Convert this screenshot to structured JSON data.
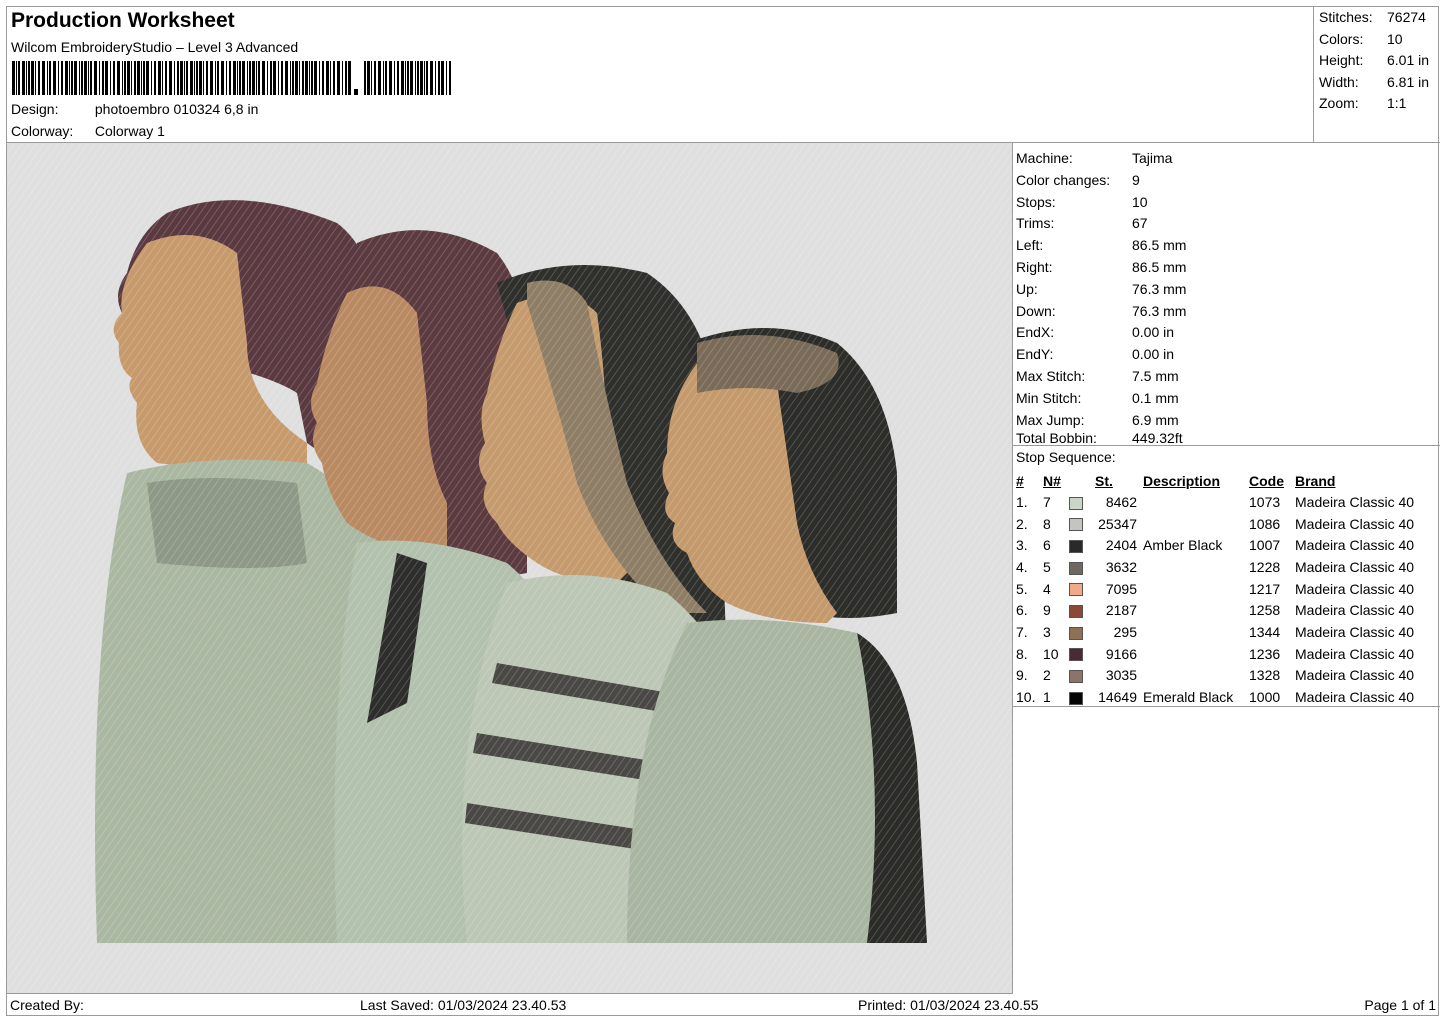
{
  "header": {
    "title": "Production Worksheet",
    "subtitle": "Wilcom EmbroideryStudio – Level 3 Advanced",
    "design_label": "Design:",
    "design_value": "photoembro 010324 6,8 in",
    "colorway_label": "Colorway:",
    "colorway_value": "Colorway 1"
  },
  "summary": [
    {
      "label": "Stitches:",
      "value": "76274"
    },
    {
      "label": "Colors:",
      "value": "10"
    },
    {
      "label": "Height:",
      "value": "6.01 in"
    },
    {
      "label": "Width:",
      "value": "6.81 in"
    },
    {
      "label": "Zoom:",
      "value": "1:1"
    }
  ],
  "info": [
    {
      "label": "Machine:",
      "value": "Tajima"
    },
    {
      "label": "Color changes:",
      "value": "9"
    },
    {
      "label": "Stops:",
      "value": "10"
    },
    {
      "label": "Trims:",
      "value": "67"
    },
    {
      "label": "Left:",
      "value": "86.5 mm"
    },
    {
      "label": "Right:",
      "value": "86.5 mm"
    },
    {
      "label": "Up:",
      "value": "76.3 mm"
    },
    {
      "label": "Down:",
      "value": "76.3 mm"
    },
    {
      "label": "EndX:",
      "value": "0.00 in"
    },
    {
      "label": "EndY:",
      "value": "0.00 in"
    },
    {
      "label": "Max Stitch:",
      "value": "7.5 mm"
    },
    {
      "label": "Min Stitch:",
      "value": "0.1 mm"
    },
    {
      "label": "Max Jump:",
      "value": "6.9 mm"
    },
    {
      "label": "Total Bobbin:",
      "value": "449.32ft"
    }
  ],
  "stops": {
    "caption": "Stop Sequence:",
    "headers": {
      "num": "#",
      "n": "N#",
      "st": "St.",
      "desc": "Description",
      "code": "Code",
      "brand": "Brand"
    },
    "rows": [
      {
        "num": "1.",
        "n": "7",
        "color": "#c9d6c9",
        "st": "8462",
        "desc": "",
        "code": "1073",
        "brand": "Madeira Classic 40"
      },
      {
        "num": "2.",
        "n": "8",
        "color": "#c4c4c0",
        "st": "25347",
        "desc": "",
        "code": "1086",
        "brand": "Madeira Classic 40"
      },
      {
        "num": "3.",
        "n": "6",
        "color": "#2a2a28",
        "st": "2404",
        "desc": "Amber Black",
        "code": "1007",
        "brand": "Madeira Classic 40"
      },
      {
        "num": "4.",
        "n": "5",
        "color": "#6e6860",
        "st": "3632",
        "desc": "",
        "code": "1228",
        "brand": "Madeira Classic 40"
      },
      {
        "num": "5.",
        "n": "4",
        "color": "#f1a98a",
        "st": "7095",
        "desc": "",
        "code": "1217",
        "brand": "Madeira Classic 40"
      },
      {
        "num": "6.",
        "n": "9",
        "color": "#8b4a36",
        "st": "2187",
        "desc": "",
        "code": "1258",
        "brand": "Madeira Classic 40"
      },
      {
        "num": "7.",
        "n": "3",
        "color": "#8f7256",
        "st": "295",
        "desc": "",
        "code": "1344",
        "brand": "Madeira Classic 40"
      },
      {
        "num": "8.",
        "n": "10",
        "color": "#4a2a36",
        "st": "9166",
        "desc": "",
        "code": "1236",
        "brand": "Madeira Classic 40"
      },
      {
        "num": "9.",
        "n": "2",
        "color": "#8d7468",
        "st": "3035",
        "desc": "",
        "code": "1328",
        "brand": "Madeira Classic 40"
      },
      {
        "num": "10.",
        "n": "1",
        "color": "#050505",
        "st": "14649",
        "desc": "Emerald Black",
        "code": "1000",
        "brand": "Madeira Classic 40"
      }
    ]
  },
  "footer": {
    "created": "Created By:",
    "saved": "Last Saved: 01/03/2024 23.40.53",
    "printed": "Printed: 01/03/2024 23.40.55",
    "page": "Page 1 of 1"
  }
}
